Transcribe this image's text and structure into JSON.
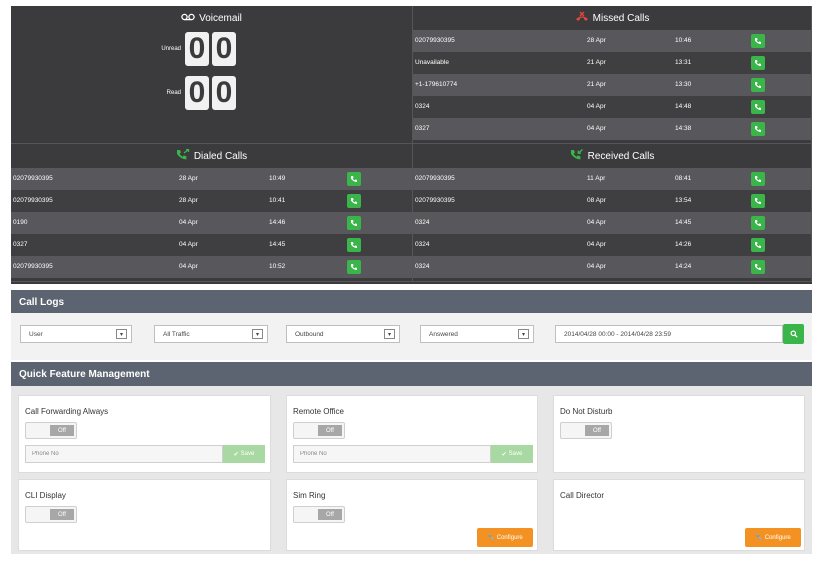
{
  "voicemail": {
    "title": "Voicemail",
    "unread_label": "Unread",
    "read_label": "Read",
    "unread_digits": [
      "0",
      "0"
    ],
    "read_digits": [
      "0",
      "0"
    ]
  },
  "missed_calls": {
    "title": "Missed Calls",
    "rows": [
      {
        "number": "02079930395",
        "date": "28 Apr",
        "time": "10:46"
      },
      {
        "number": "Unavailable",
        "date": "21 Apr",
        "time": "13:31"
      },
      {
        "number": "+1-179610774",
        "date": "21 Apr",
        "time": "13:30"
      },
      {
        "number": "0324",
        "date": "04 Apr",
        "time": "14:48"
      },
      {
        "number": "0327",
        "date": "04 Apr",
        "time": "14:38"
      }
    ]
  },
  "dialed_calls": {
    "title": "Dialed Calls",
    "rows": [
      {
        "number": "02079930395",
        "date": "28 Apr",
        "time": "10:49"
      },
      {
        "number": "02079930395",
        "date": "28 Apr",
        "time": "10:41"
      },
      {
        "number": "0190",
        "date": "04 Apr",
        "time": "14:46"
      },
      {
        "number": "0327",
        "date": "04 Apr",
        "time": "14:45"
      },
      {
        "number": "02079930395",
        "date": "04 Apr",
        "time": "10:52"
      }
    ]
  },
  "received_calls": {
    "title": "Received Calls",
    "rows": [
      {
        "number": "02079930395",
        "date": "11 Apr",
        "time": "08:41"
      },
      {
        "number": "02079930395",
        "date": "08 Apr",
        "time": "13:54"
      },
      {
        "number": "0324",
        "date": "04 Apr",
        "time": "14:45"
      },
      {
        "number": "0324",
        "date": "04 Apr",
        "time": "14:26"
      },
      {
        "number": "0324",
        "date": "04 Apr",
        "time": "14:24"
      }
    ]
  },
  "call_logs": {
    "title": "Call Logs",
    "filters": {
      "user": "User",
      "traffic": "All Traffic",
      "direction": "Outbound",
      "status": "Answered"
    },
    "date_range": "2014/04/28 00:00 - 2014/04/28 23:59"
  },
  "quick_features": {
    "title": "Quick Feature Management",
    "off_label": "Off",
    "phone_placeholder": "Phone No",
    "save_label": "Save",
    "configure_label": "Configure",
    "cards": {
      "call_forwarding_always": "Call Forwarding Always",
      "remote_office": "Remote Office",
      "do_not_disturb": "Do Not Disturb",
      "cli_display": "CLI Display",
      "sim_ring": "Sim Ring",
      "call_director": "Call Director"
    }
  },
  "colors": {
    "dashboard_bg": "#3b3b3e",
    "accent_green": "#3ab54a",
    "missed_red": "#e2463e",
    "header_slate": "#5b6470",
    "configure_orange": "#f39223"
  }
}
